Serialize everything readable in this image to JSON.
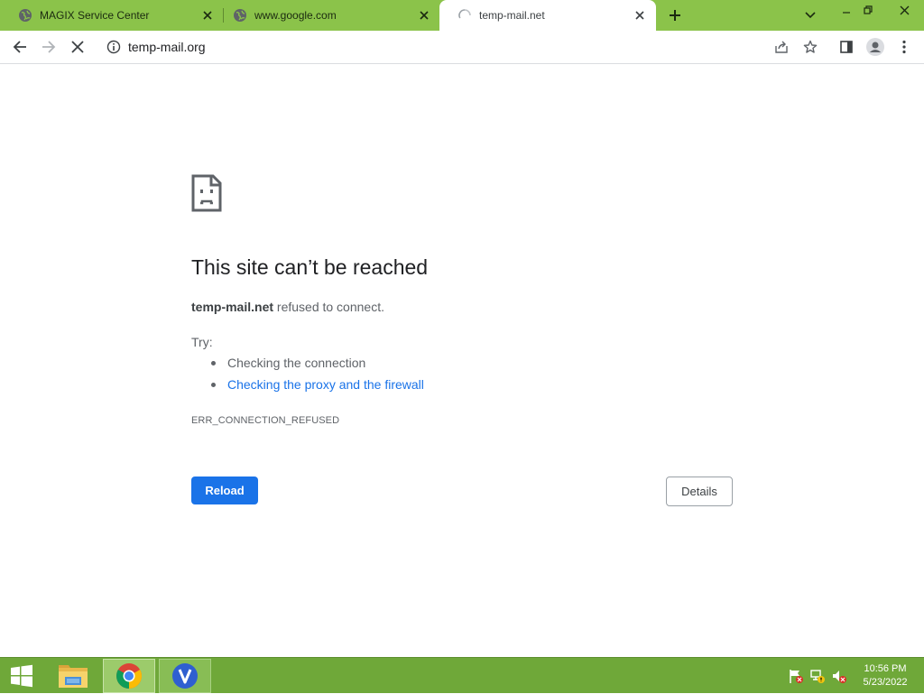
{
  "tabs": [
    {
      "title": "MAGIX Service Center",
      "favicon": "globe-icon",
      "state": "inactive"
    },
    {
      "title": "www.google.com",
      "favicon": "globe-icon",
      "state": "inactive"
    },
    {
      "title": "temp-mail.net",
      "favicon": "loading-spinner-icon",
      "state": "active"
    }
  ],
  "toolbar": {
    "url": "temp-mail.org"
  },
  "error_page": {
    "title": "This site can’t be reached",
    "host": "temp-mail.net",
    "message": " refused to connect.",
    "try_label": "Try:",
    "suggestions": [
      "Checking the connection",
      "Checking the proxy and the firewall"
    ],
    "error_code": "ERR_CONNECTION_REFUSED",
    "reload_label": "Reload",
    "details_label": "Details"
  },
  "taskbar": {
    "apps": [
      "file-explorer-icon",
      "chrome-icon",
      "v-app-icon"
    ],
    "time": "10:56 PM",
    "date": "5/23/2022"
  },
  "colors": {
    "frame": "#8bc34a",
    "taskbar": "#6fa839",
    "accent": "#1a73e8"
  }
}
